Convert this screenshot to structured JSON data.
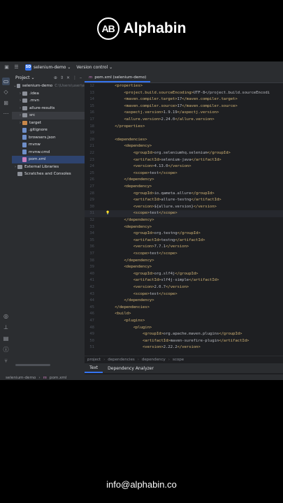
{
  "brand": {
    "logo_text": "AB",
    "name": "Alphabin"
  },
  "footer": {
    "email": "info@alphabin.co"
  },
  "titlebar": {
    "project_badge": "SD",
    "project_name": "selenium-demo",
    "vcs": "Version control"
  },
  "project_panel": {
    "title": "Project",
    "root": {
      "name": "selenium-demo",
      "path": "C:\\Users\\user\\e"
    },
    "items": [
      {
        "label": ".idea",
        "kind": "folder"
      },
      {
        "label": ".mvn",
        "kind": "folder"
      },
      {
        "label": "allure-results",
        "kind": "folder"
      },
      {
        "label": "src",
        "kind": "folder"
      },
      {
        "label": "target",
        "kind": "folder-orange"
      },
      {
        "label": ".gitignore",
        "kind": "file"
      },
      {
        "label": "browsers.json",
        "kind": "file"
      },
      {
        "label": "mvnw",
        "kind": "file"
      },
      {
        "label": "mvnw.cmd",
        "kind": "file"
      },
      {
        "label": "pom.xml",
        "kind": "pom"
      }
    ],
    "external": "External Libraries",
    "scratches": "Scratches and Consoles"
  },
  "editor": {
    "tab_icon": "m",
    "tab_label": "pom.xml (selenium-demo)",
    "lines": [
      {
        "n": "12",
        "code": "    <properties>"
      },
      {
        "n": "13",
        "code": "        <project.build.sourceEncoding>UTF-8</project.build.sourceEncodi"
      },
      {
        "n": "14",
        "code": "        <maven.compiler.target>17</maven.compiler.target>"
      },
      {
        "n": "15",
        "code": "        <maven.compiler.source>17</maven.compiler.source>"
      },
      {
        "n": "16",
        "code": "        <aspectj.version>1.9.19</aspectj.version>"
      },
      {
        "n": "17",
        "code": "        <allure.version>2.24.0</allure.version>"
      },
      {
        "n": "18",
        "code": "    </properties>"
      },
      {
        "n": "19",
        "code": ""
      },
      {
        "n": "20",
        "code": "    <dependencies>"
      },
      {
        "n": "21",
        "code": "        <dependency>"
      },
      {
        "n": "22",
        "code": "            <groupId>org.seleniumhq.selenium</groupId>"
      },
      {
        "n": "23",
        "code": "            <artifactId>selenium-java</artifactId>"
      },
      {
        "n": "24",
        "code": "            <version>4.13.0</version>"
      },
      {
        "n": "25",
        "code": "            <scope>test</scope>"
      },
      {
        "n": "26",
        "code": "        </dependency>"
      },
      {
        "n": "27",
        "code": "        <dependency>"
      },
      {
        "n": "28",
        "code": "            <groupId>io.qameta.allure</groupId>"
      },
      {
        "n": "29",
        "code": "            <artifactId>allure-testng</artifactId>"
      },
      {
        "n": "30",
        "code": "            <version>${allure.version}</version>"
      },
      {
        "n": "31",
        "code": "            <scope>test</scope>"
      },
      {
        "n": "32",
        "code": "        </dependency>"
      },
      {
        "n": "33",
        "code": "        <dependency>"
      },
      {
        "n": "34",
        "code": "            <groupId>org.testng</groupId>"
      },
      {
        "n": "35",
        "code": "            <artifactId>testng</artifactId>"
      },
      {
        "n": "36",
        "code": "            <version>7.7.1</version>"
      },
      {
        "n": "37",
        "code": "            <scope>test</scope>"
      },
      {
        "n": "38",
        "code": "        </dependency>"
      },
      {
        "n": "39",
        "code": "        <dependency>"
      },
      {
        "n": "40",
        "code": "            <groupId>org.slf4j</groupId>"
      },
      {
        "n": "41",
        "code": "            <artifactId>slf4j-simple</artifactId>"
      },
      {
        "n": "42",
        "code": "            <version>2.0.7</version>"
      },
      {
        "n": "43",
        "code": "            <scope>test</scope>"
      },
      {
        "n": "44",
        "code": "        </dependency>"
      },
      {
        "n": "45",
        "code": "    </dependencies>"
      },
      {
        "n": "46",
        "code": "    <build>"
      },
      {
        "n": "47",
        "code": "        <plugins>"
      },
      {
        "n": "48",
        "code": "            <plugin>"
      },
      {
        "n": "49",
        "code": "                <groupId>org.apache.maven.plugins</groupId>"
      },
      {
        "n": "50",
        "code": "                <artifactId>maven-surefire-plugin</artifactId>"
      },
      {
        "n": "51",
        "code": "                <version>2.22.2</version>"
      }
    ],
    "current_line": "31",
    "breadcrumbs": [
      "project",
      "dependencies",
      "dependency",
      "scope"
    ],
    "bottom_tabs": [
      "Text",
      "Dependency Analyzer"
    ]
  },
  "statusbar": {
    "project": "selenium-demo",
    "file_icon": "m",
    "file": "pom.xml"
  },
  "colors": {
    "accent": "#3574f0",
    "tag": "#d5b778",
    "bg": "#1e1f22"
  }
}
